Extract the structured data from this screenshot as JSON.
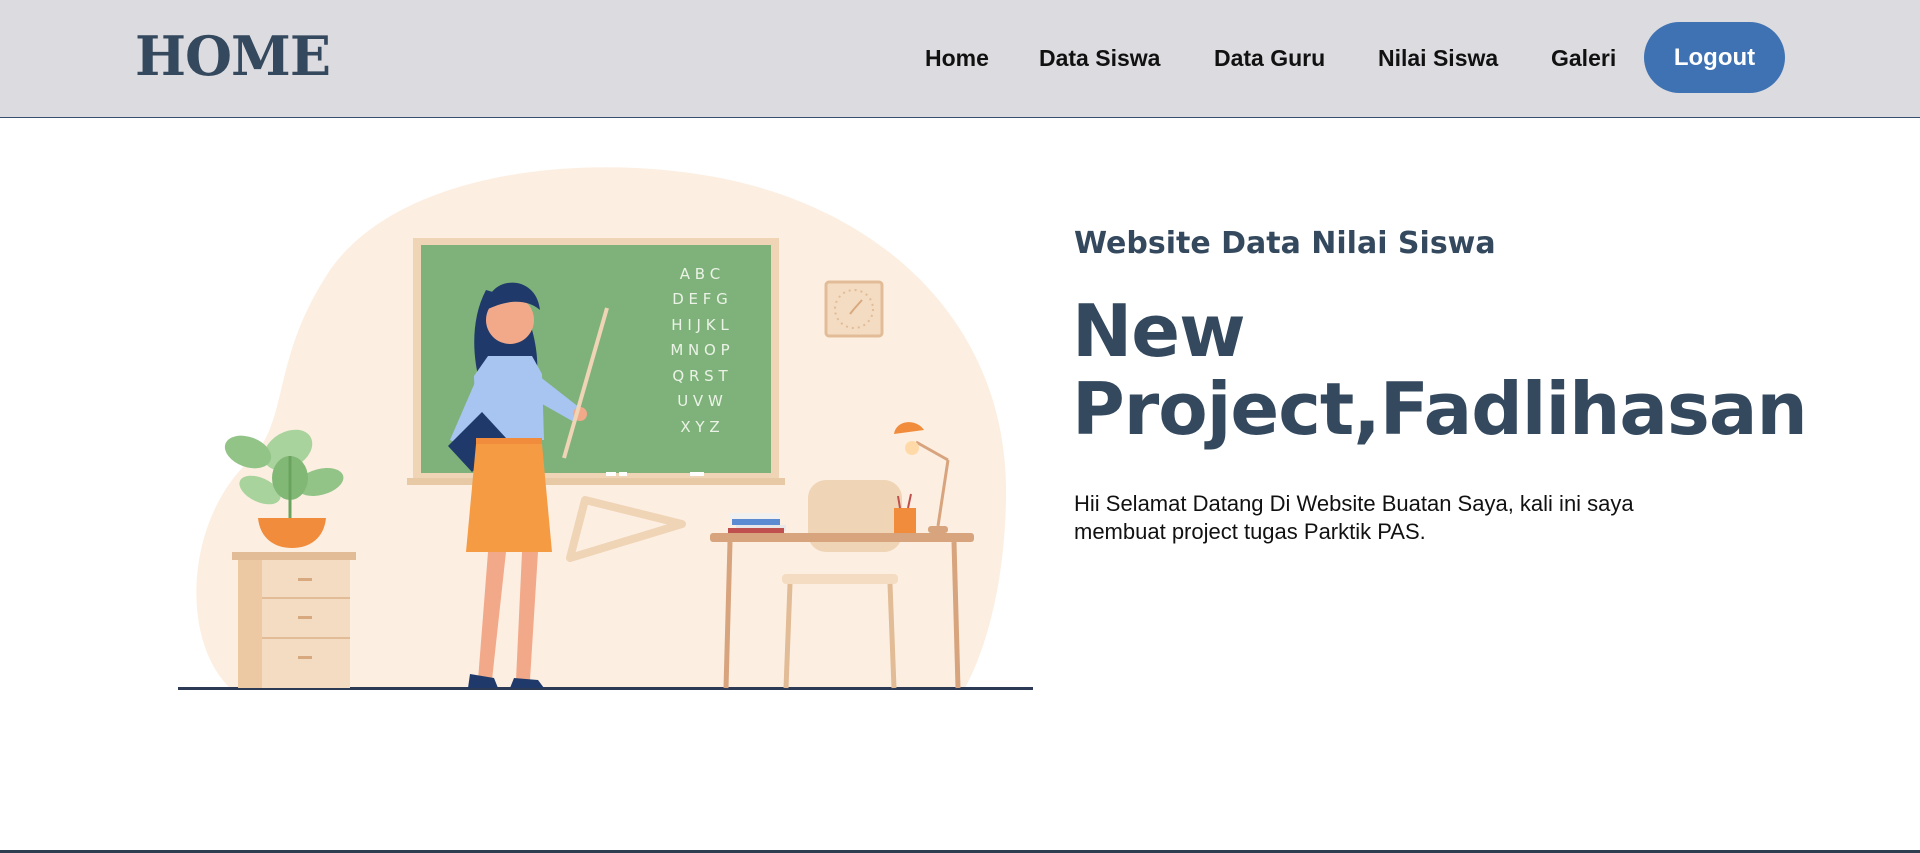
{
  "header": {
    "logo": "HOME",
    "nav": [
      {
        "label": "Home"
      },
      {
        "label": "Data Siswa"
      },
      {
        "label": "Data Guru"
      },
      {
        "label": "Nilai Siswa"
      },
      {
        "label": "Galeri"
      }
    ],
    "logout_label": "Logout"
  },
  "hero": {
    "subtitle": "Website Data Nilai Siswa",
    "title_line1": "New",
    "title_line2": "Project,Fadlihasan",
    "description": "Hii Selamat Datang Di Website Buatan Saya, kali ini saya membuat project tugas Parktik PAS.",
    "illustration": {
      "board_letters": [
        "A B C",
        "D E F G",
        "H I J K L",
        "M N O P",
        "Q R S T",
        "U V W",
        "X Y Z"
      ]
    }
  },
  "colors": {
    "nav_bg": "#dcdbe0",
    "brand": "#34495e",
    "button": "#3e72b2",
    "board": "#7fb27a"
  }
}
